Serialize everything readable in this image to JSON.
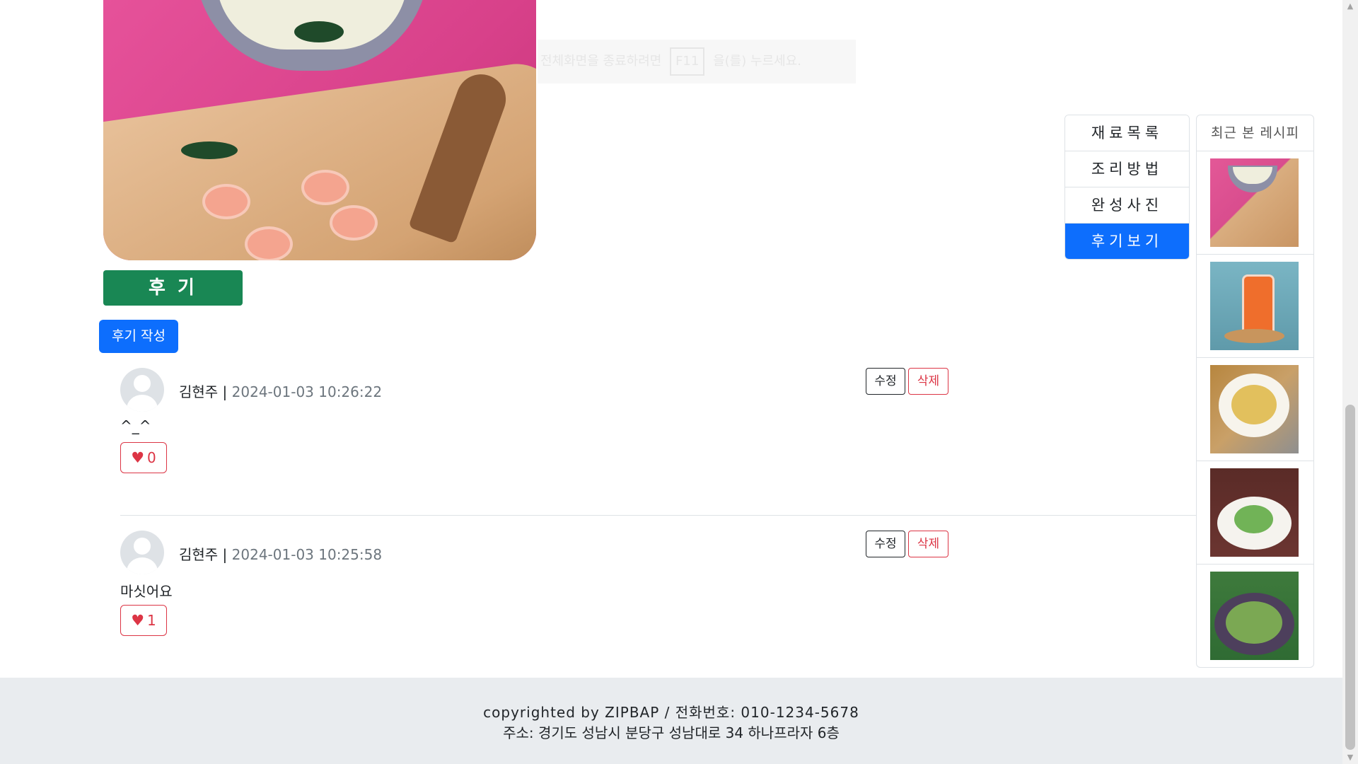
{
  "notice": {
    "text_before": "전체화면을 종료하려면",
    "key": "F11",
    "text_after": "을(를) 누르세요."
  },
  "review_section": {
    "title": "후 기",
    "write_button": "후기 작성"
  },
  "reviews": [
    {
      "author": "김현주",
      "separator": " | ",
      "date": "2024-01-03 10:26:22",
      "content": "^_^",
      "likes": "0",
      "edit_label": "수정",
      "delete_label": "삭제"
    },
    {
      "author": "김현주",
      "separator": " | ",
      "date": "2024-01-03 10:25:58",
      "content": "마싯어요",
      "likes": "1",
      "edit_label": "수정",
      "delete_label": "삭제"
    }
  ],
  "toc": {
    "items": [
      "재료목록",
      "조리방법",
      "완성사진",
      "후기보기"
    ],
    "active": "후기보기"
  },
  "recent": {
    "title": "최근 본 레시피"
  },
  "footer": {
    "line1": "copyrighted by ZIPBAP / 전화번호: 010-1234-5678",
    "line2": "주소: 경기도 성남시 분당구 성남대로 34 하나프라자 6층"
  },
  "colors": {
    "primary": "#0d6efd",
    "success": "#198754",
    "danger": "#dc3545",
    "footer_bg": "#e9ecef"
  }
}
